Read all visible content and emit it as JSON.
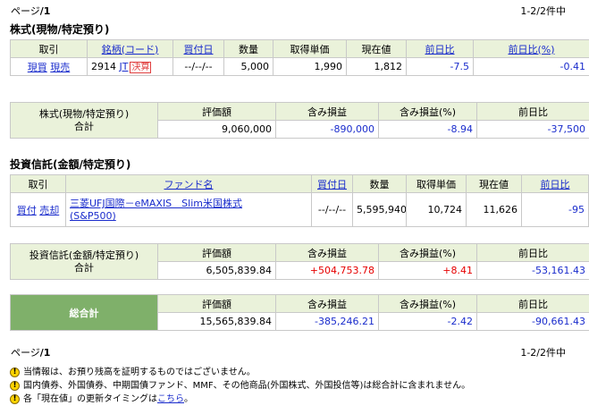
{
  "pager_top": {
    "page_label": "ページ",
    "page": "/1",
    "count": "1-2/2件中"
  },
  "pager_bottom": {
    "page_label": "ページ",
    "page": "/1",
    "count": "1-2/2件中"
  },
  "stock": {
    "title": "株式(現物/特定預り)",
    "headers": [
      "取引",
      "銘柄(コード)",
      "買付日",
      "数量",
      "取得単価",
      "現在値",
      "前日比",
      "前日比(%)"
    ],
    "row": {
      "buy": "現買",
      "sell": "現売",
      "code": "2914",
      "name": "JT",
      "badge": "決算",
      "date": "--/--/--",
      "qty": "5,000",
      "cost": "1,990",
      "price": "1,812",
      "change": "-7.5",
      "change_pct": "-0.41"
    },
    "summary": {
      "label1": "株式(現物/特定預り)",
      "label2": "合計",
      "headers": [
        "評価額",
        "含み損益",
        "含み損益(%)",
        "前日比"
      ],
      "values": [
        "9,060,000",
        "-890,000",
        "-8.94",
        "-37,500"
      ]
    }
  },
  "fund": {
    "title": "投資信託(金額/特定預り)",
    "headers": [
      "取引",
      "ファンド名",
      "買付日",
      "数量",
      "取得単価",
      "現在値",
      "前日比"
    ],
    "row": {
      "buy": "買付",
      "sell": "売却",
      "name1": "三菱UFJ国際－eMAXIS　Slim米国株式",
      "name2": "(S&P500)",
      "date": "--/--/--",
      "qty": "5,595,940",
      "cost": "10,724",
      "price": "11,626",
      "change": "-95"
    },
    "summary": {
      "label1": "投資信託(金額/特定預り)",
      "label2": "合計",
      "headers": [
        "評価額",
        "含み損益",
        "含み損益(%)",
        "前日比"
      ],
      "values": [
        "6,505,839.84",
        "+504,753.78",
        "+8.41",
        "-53,161.43"
      ]
    }
  },
  "total": {
    "label": "総合計",
    "headers": [
      "評価額",
      "含み損益",
      "含み損益(%)",
      "前日比"
    ],
    "values": [
      "15,565,839.84",
      "-385,246.21",
      "-2.42",
      "-90,661.43"
    ]
  },
  "notes": {
    "n1": "当情報は、お預り残高を証明するものではございません。",
    "n2": "国内債券、外国債券、中期国債ファンド、MMF、その他商品(外国株式、外国投信等)は総合計に含まれません。",
    "n3_pre": "各「現在値」の更新タイミングは",
    "n3_link": "こちら",
    "n3_post": "。"
  },
  "colors": {
    "header_bg": "#eaf2da",
    "total_bg": "#7fb06a",
    "negative": "#1a2ccc",
    "positive": "#e60000"
  }
}
